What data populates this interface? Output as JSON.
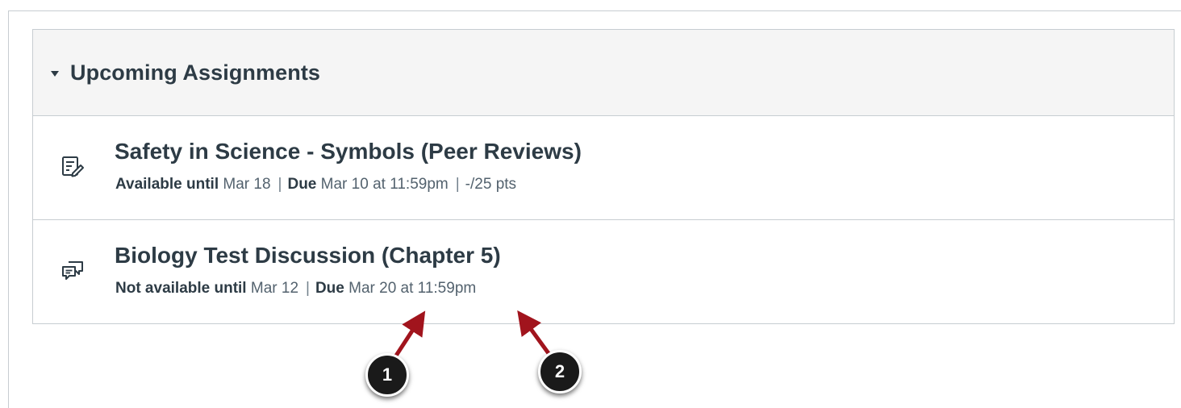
{
  "module": {
    "title": "Upcoming Assignments",
    "items": [
      {
        "title": "Safety in Science - Symbols (Peer Reviews)",
        "icon": "peer-review-assignment-icon",
        "availability_label": "Available until",
        "availability_date": "Mar 18",
        "due_label": "Due",
        "due_date": "Mar 10 at 11:59pm",
        "points": "-/25 pts"
      },
      {
        "title": "Biology Test Discussion (Chapter 5)",
        "icon": "discussion-icon",
        "availability_label": "Not available until",
        "availability_date": "Mar 12",
        "due_label": "Due",
        "due_date": "Mar 20 at 11:59pm"
      }
    ]
  },
  "callouts": [
    {
      "label": "1"
    },
    {
      "label": "2"
    }
  ],
  "colors": {
    "text": "#2d3b45",
    "meta": "#53626e",
    "border": "#c7cdd1",
    "header_bg": "#f5f5f5",
    "arrow": "#a1141d",
    "callout_bg": "#1a1a1a"
  }
}
